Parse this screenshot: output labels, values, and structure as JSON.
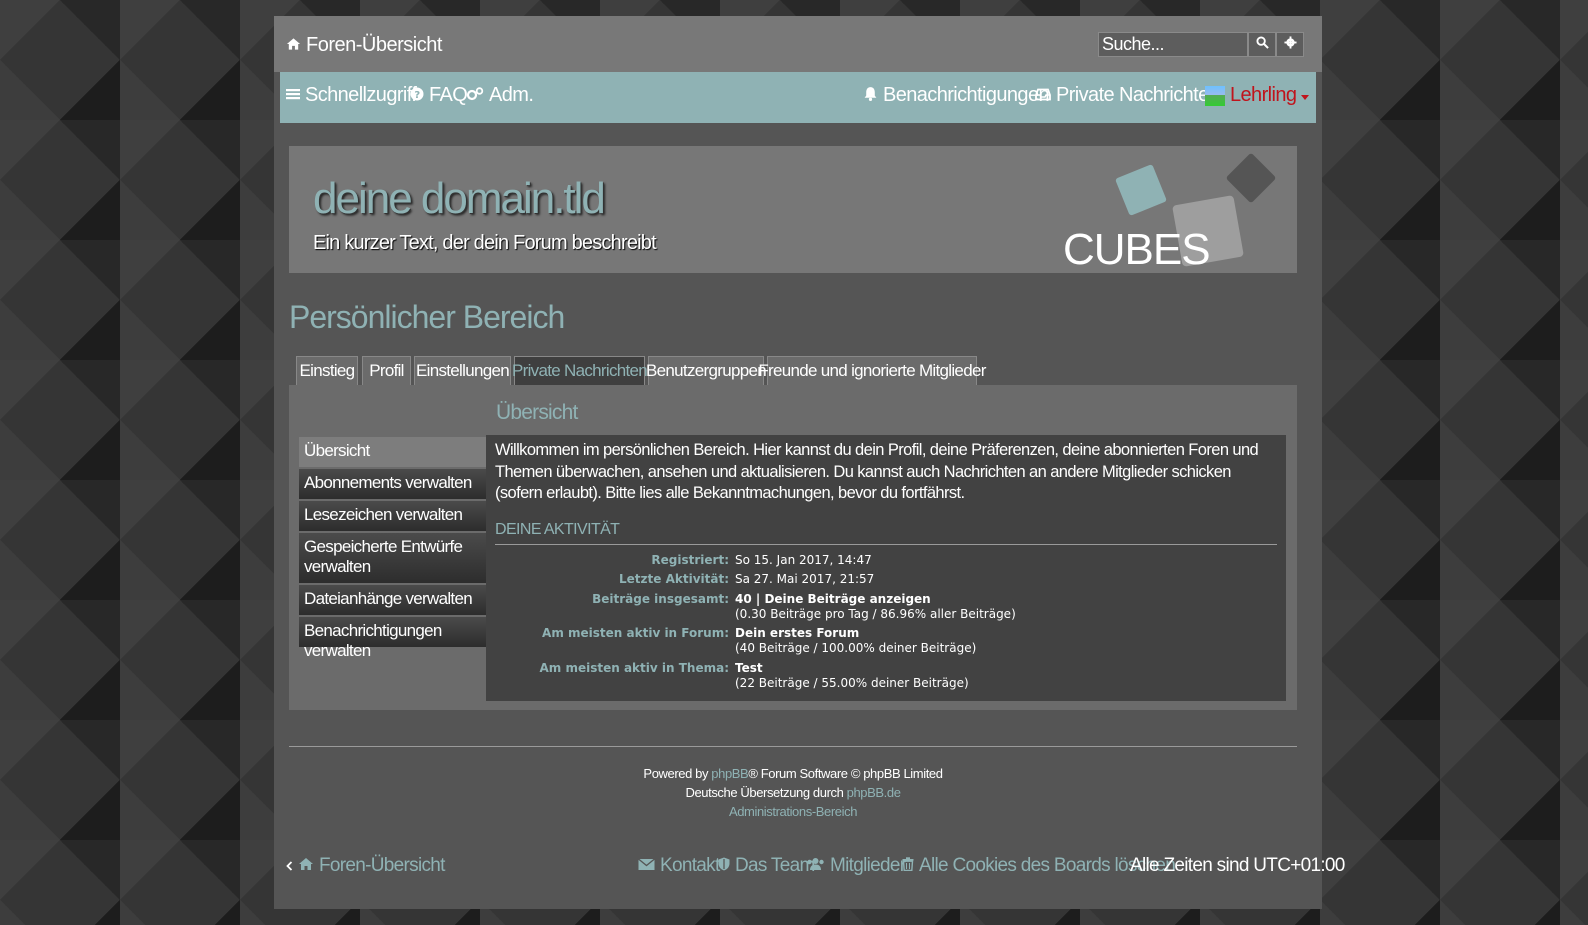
{
  "topbar": {
    "home_label": "Foren-Übersicht",
    "search_placeholder": "Suche..."
  },
  "navbar": {
    "quick_links": "Schnellzugriff",
    "faq": "FAQ",
    "acp": "Adm.",
    "notifications": "Benachrichtigungen",
    "private_messages": "Private Nachrichten",
    "username": "Lehrling"
  },
  "header": {
    "site_name": "deine domain.tld",
    "site_description": "Ein kurzer Text, der dein Forum beschreibt",
    "logo_text": "CUBES"
  },
  "page": {
    "title": "Persönlicher Bereich"
  },
  "tabs": [
    {
      "label": "Einstieg"
    },
    {
      "label": "Profil"
    },
    {
      "label": "Einstellungen"
    },
    {
      "label": "Private Nachrichten"
    },
    {
      "label": "Benutzergruppen"
    },
    {
      "label": "Freunde und ignorierte Mitglieder"
    }
  ],
  "side_menu": [
    {
      "label": "Übersicht"
    },
    {
      "label": "Abonnements verwalten"
    },
    {
      "label": "Lesezeichen verwalten"
    },
    {
      "label": "Gespeicherte Entwürfe verwalten"
    },
    {
      "label": "Dateianhänge verwalten"
    },
    {
      "label": "Benachrichtigungen verwalten"
    }
  ],
  "content": {
    "section_title": "Übersicht",
    "intro": "Willkommen im persönlichen Bereich. Hier kannst du dein Profil, deine Präferenzen, deine abonnierten Foren und Themen überwachen, ansehen und aktualisieren. Du kannst auch Nachrichten an andere Mitglieder schicken (sofern erlaubt). Bitte lies alle Bekanntmachungen, bevor du fortfährst.",
    "activity_title": "DEINE AKTIVITÄT",
    "stats": {
      "registered_label": "Registriert:",
      "registered_value": "So 15. Jan 2017, 14:47",
      "last_active_label": "Letzte Aktivität:",
      "last_active_value": "Sa 27. Mai 2017, 21:57",
      "posts_label": "Beiträge insgesamt:",
      "posts_count": "40 | ",
      "posts_link": "Deine Beiträge anzeigen",
      "posts_detail": "(0.30 Beiträge pro Tag / 86.96% aller Beiträge)",
      "active_forum_label": "Am meisten aktiv in Forum:",
      "active_forum_value": "Dein erstes Forum",
      "active_forum_detail": "(40 Beiträge / 100.00% deiner Beiträge)",
      "active_topic_label": "Am meisten aktiv in Thema:",
      "active_topic_value": "Test",
      "active_topic_detail": "(22 Beiträge / 55.00% deiner Beiträge)"
    }
  },
  "credits": {
    "powered_by": "Powered by ",
    "phpbb": "phpBB",
    "software": "® Forum Software © phpBB Limited",
    "translation": "Deutsche Übersetzung durch ",
    "phpbb_de": "phpBB.de",
    "acp_link": "Administrations-Bereich"
  },
  "footer_nav": {
    "home": "Foren-Übersicht",
    "contact": "Kontakt",
    "team": "Das Team",
    "members": "Mitglieder",
    "delete_cookies": "Alle Cookies des Boards löschen",
    "timezone": "Alle Zeiten sind UTC+01:00"
  },
  "colors": {
    "accent": "#8fb2b4",
    "user": "#c0141c",
    "panel": "#6b6b6b"
  }
}
